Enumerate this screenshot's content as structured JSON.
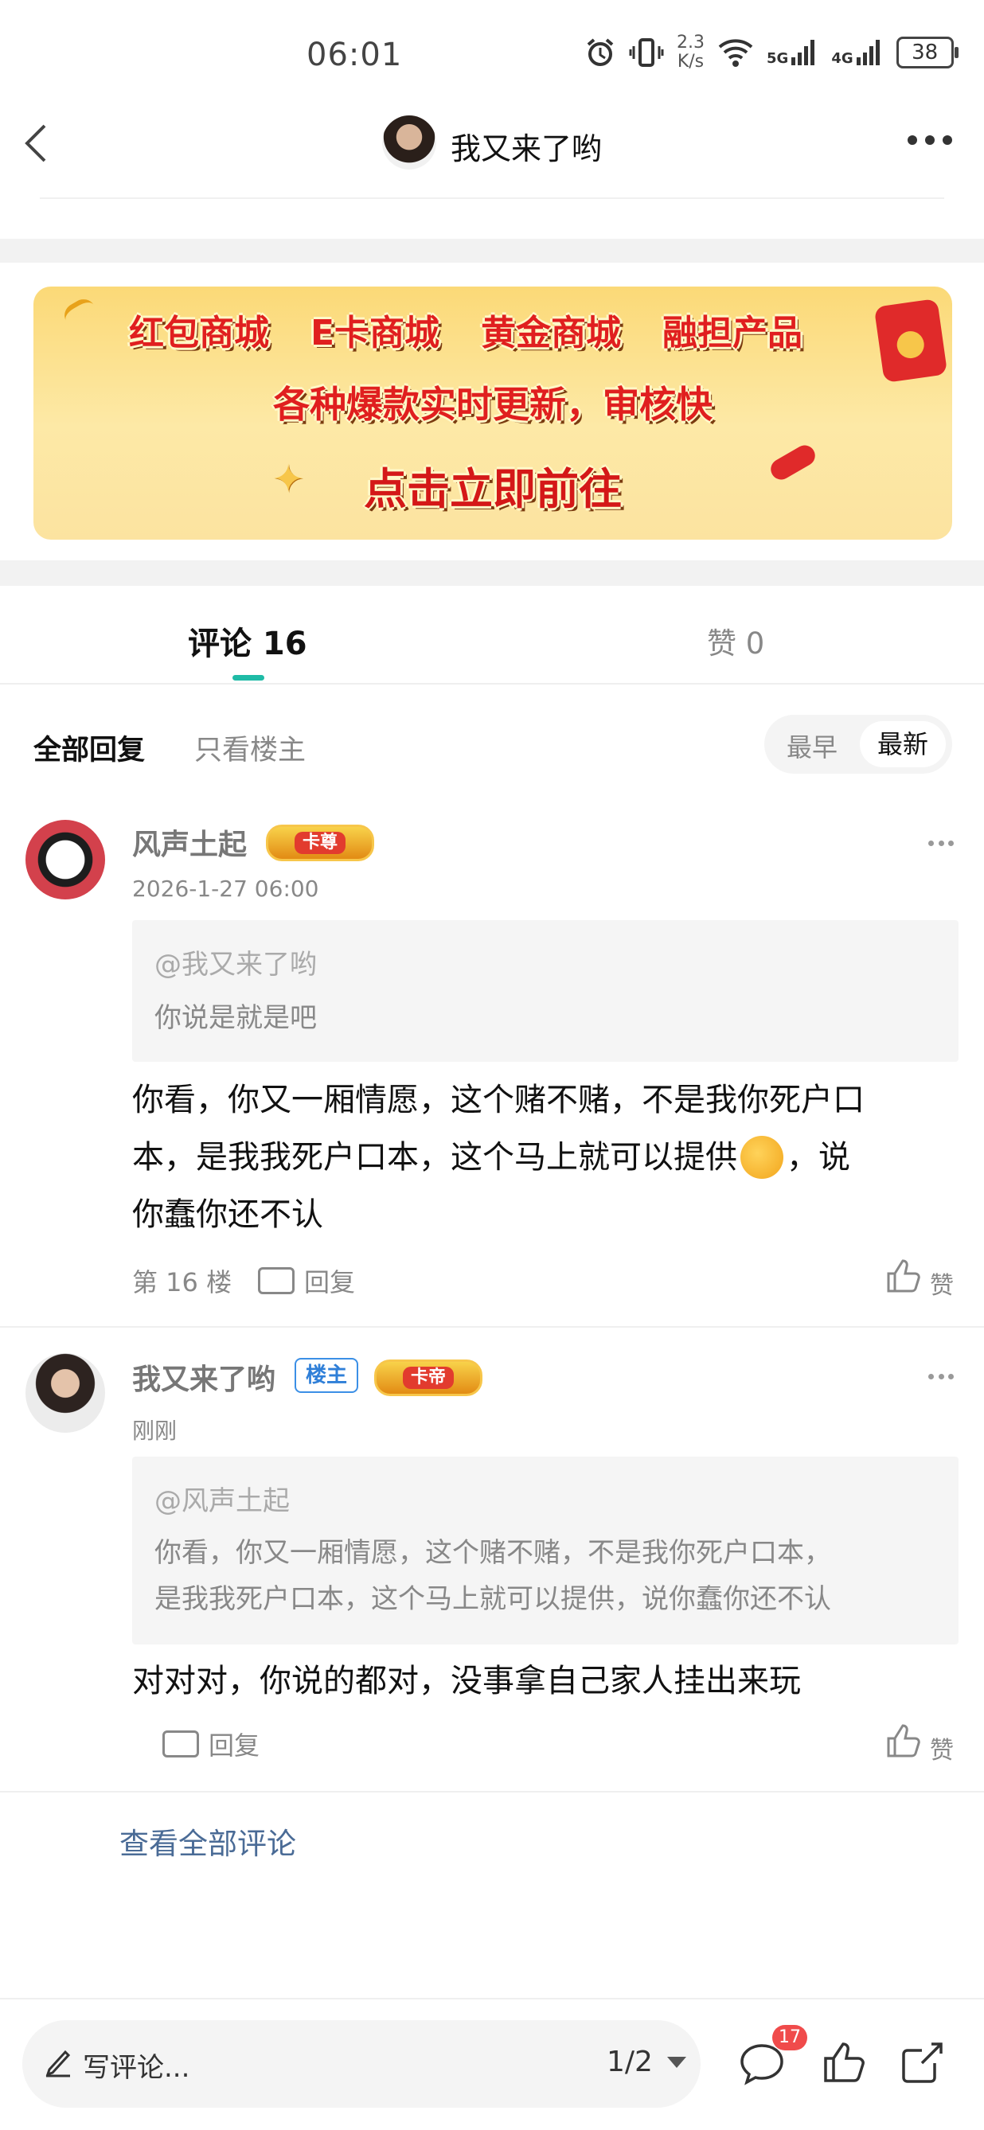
{
  "status_bar": {
    "time": "06:01",
    "net_speed_value": "2.3",
    "net_speed_unit": "K/s",
    "signal_1": "5G",
    "signal_2": "4G",
    "battery": "38"
  },
  "nav": {
    "title": "我又来了哟"
  },
  "banner": {
    "line1": [
      "红包商城",
      "E卡商城",
      "黄金商城",
      "融担产品"
    ],
    "line2": "各种爆款实时更新，审核快",
    "line3": "点击立即前往"
  },
  "tabs": {
    "comments_label": "评论 16",
    "likes_label": "赞 0"
  },
  "filter": {
    "all": "全部回复",
    "owner_only": "只看楼主",
    "sort_earliest": "最早",
    "sort_latest": "最新"
  },
  "comments": [
    {
      "user": "风声土起",
      "badge": "卡尊",
      "time": "2026-1-27 06:00",
      "quote_at": "@我又来了哟",
      "quote_text": "你说是就是吧",
      "text_line1": "你看，你又一厢情愿，这个赌不赌，不是我你死户口",
      "text_line2": "本，是我我死户口本，这个马上就可以提供",
      "text_line2_end": "，说",
      "text_line3": "你蠢你还不认",
      "floor": "第 16 楼",
      "reply": "回复",
      "like": "赞"
    },
    {
      "user": "我又来了哟",
      "owner_tag": "楼主",
      "badge": "卡帝",
      "time": "刚刚",
      "quote_at": "@风声土起",
      "quote_line1": "你看，你又一厢情愿，这个赌不赌，不是我你死户口本，",
      "quote_line2": "是我我死户口本，这个马上就可以提供，说你蠢你还不认",
      "text": "对对对，你说的都对，没事拿自己家人挂出来玩",
      "reply": "回复",
      "like": "赞"
    }
  ],
  "view_all": "查看全部评论",
  "bottom_bar": {
    "placeholder": "写评论...",
    "pager": "1/2",
    "comment_count": "17"
  }
}
